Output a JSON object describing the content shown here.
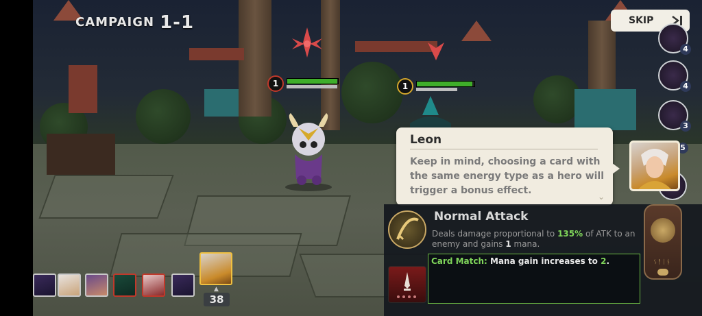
{
  "header": {
    "campaign_label": "CAMPAIGN",
    "level": "1-1"
  },
  "skip": {
    "label": "SKIP"
  },
  "enemies": [
    {
      "level": "1",
      "health": 0.99
    },
    {
      "level": "1",
      "health": 0.97
    }
  ],
  "dialog": {
    "speaker": "Leon",
    "message": "Keep in mind, choosing a card with the same energy type as a hero will trigger a bonus effect."
  },
  "skill_slots": [
    {
      "count": "4"
    },
    {
      "count": "4"
    },
    {
      "count": "3"
    },
    {
      "count": "5"
    }
  ],
  "skill": {
    "title": "Normal Attack",
    "desc_before": "Deals damage proportional to ",
    "desc_pct": "135%",
    "desc_mid": " of ATK to an enemy and gains ",
    "desc_num": "1",
    "desc_after": " mana.",
    "card_match_label": "Card Match:",
    "card_match_text": " Mana gain increases to ",
    "card_match_value": "2",
    "card_match_end": "."
  },
  "turn_order": {
    "count": "38"
  },
  "colors": {
    "accent_green": "#7fd45a",
    "health_green": "#3fae2a",
    "enemy_red": "#c0392b"
  }
}
